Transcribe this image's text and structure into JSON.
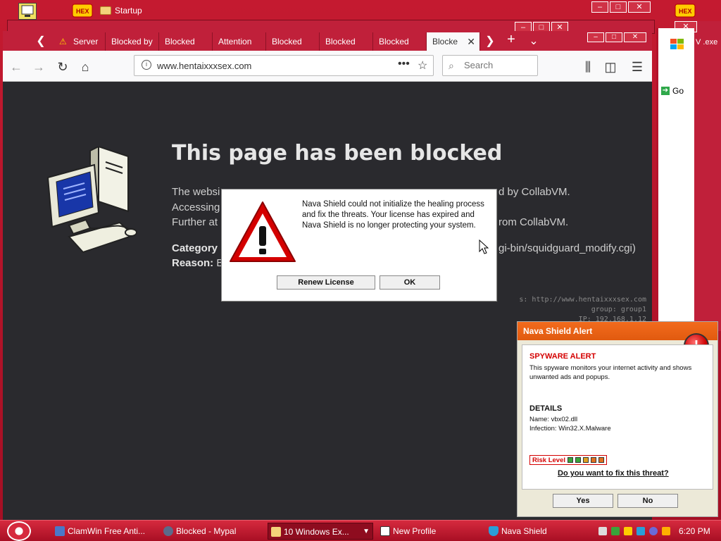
{
  "desktop": {
    "startup_label": "Startup",
    "partial_label": "Go",
    "partial_exe": "V .exe"
  },
  "browser": {
    "tabs": [
      {
        "label": "Server"
      },
      {
        "label": "Blocked by"
      },
      {
        "label": "Blocked"
      },
      {
        "label": "Attention"
      },
      {
        "label": "Blocked"
      },
      {
        "label": "Blocked"
      },
      {
        "label": "Blocked"
      },
      {
        "label": "Blocke"
      }
    ],
    "url": "www.hentaixxxsex.com",
    "search_placeholder": "Search"
  },
  "blocked_page": {
    "title": "This page has been blocked",
    "line1": "The websi",
    "line1_right": "d by CollabVM.",
    "line2": "Accessing",
    "line3": "Further at",
    "line3_right": "rom CollabVM.",
    "category_label": "Category",
    "category_right": "gi-bin/squidguard_modify.cgi)",
    "reason_label": "Reason:",
    "reason_value": "B",
    "mono1": "s: http://www.hentaixxxsex.com",
    "mono2": "group: group1",
    "mono3": "IP: 192.168.1.12"
  },
  "alert": {
    "message": "Nava Shield could not initialize the healing process and fix the threats. Your license has expired and Nava Shield is no longer protecting your system.",
    "renew_label": "Renew License",
    "ok_label": "OK"
  },
  "nava_popup": {
    "title": "Nava Shield Alert",
    "spyware_heading": "SPYWARE ALERT",
    "spyware_desc": "This spyware monitors your internet activity and shows unwanted ads and popups.",
    "details_heading": "DETAILS",
    "name_line": "Name: vbx02.dll",
    "infection_line": "Infection: Win32.X.Malware",
    "risk_label": "Risk Level",
    "question": "Do you want to fix this threat?",
    "yes_label": "Yes",
    "no_label": "No"
  },
  "taskbar": {
    "tasks": [
      {
        "label": "ClamWin Free Anti..."
      },
      {
        "label": "Blocked - Mypal"
      },
      {
        "label": "10 Windows Ex..."
      },
      {
        "label": "New Profile"
      },
      {
        "label": "Nava Shield"
      }
    ],
    "clock": "6:20 PM"
  },
  "colors": {
    "desktop_red": "#b3132b",
    "nava_orange": "#f26b1d",
    "alert_red": "#d40000"
  }
}
